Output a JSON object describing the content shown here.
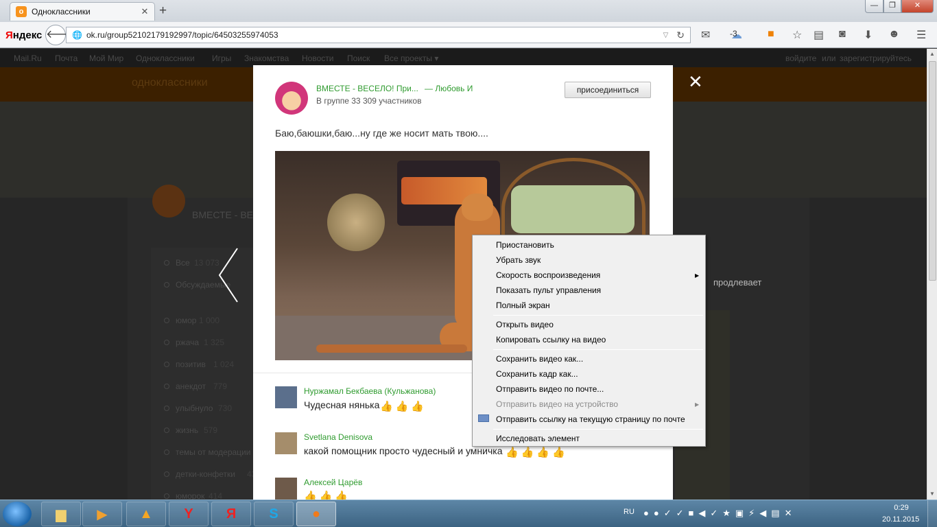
{
  "browser": {
    "tab_title": "Одноклассники",
    "tab_favicon": "ok",
    "new_tab_icon": "+",
    "brand_prefix": "Я",
    "brand_rest": "ндекс",
    "url": "ok.ru/group52102179192997/topic/64503255974053",
    "weather_temp": "-3",
    "window": {
      "min": "—",
      "max": "❐",
      "close": "✕"
    }
  },
  "bg_page": {
    "portal_links": [
      "Mail.Ru",
      "Почта",
      "Мой Мир",
      "Одноклассники",
      "Игры",
      "Знакомства",
      "Новости",
      "Поиск",
      "Все проекты ▾"
    ],
    "login": "войдите",
    "or": "или",
    "register": "зарегистрируйтесь",
    "site_name": "одноклассники",
    "group_title": "ВМЕСТЕ - ВЕ",
    "right_text": "продлевает",
    "sidebar": [
      {
        "label": "Все",
        "count": "13 073"
      },
      {
        "label": "Обсуждаемые",
        "count": ""
      },
      {
        "label": "юмор",
        "count": "1 000"
      },
      {
        "label": "ржача",
        "count": "1 325"
      },
      {
        "label": "позитив",
        "count": "1 024"
      },
      {
        "label": "анекдот",
        "count": "779"
      },
      {
        "label": "улыбнуло",
        "count": "730"
      },
      {
        "label": "жизнь",
        "count": "579"
      },
      {
        "label": "темы от модерации",
        "count": ""
      },
      {
        "label": "детки-конфетки",
        "count": "430"
      },
      {
        "label": "юморок",
        "count": "414"
      }
    ]
  },
  "post": {
    "group_name": "ВМЕСТЕ - ВЕСЕЛО! При...",
    "author": "— Любовь И",
    "members": "В группе 33 309 участников",
    "join_label": "присоединиться",
    "text": "Баю,баюшки,баю...ну где же носит мать твою...."
  },
  "comments": [
    {
      "name": "Нуржамал Бекбаева (Кульжанова)",
      "text": "Чудесная нянька",
      "thumbs": "👍👍👍"
    },
    {
      "name": "Svetlana Denisova",
      "text": "какой помощник просто чудесный и умничка",
      "thumbs": "👍👍👍👍"
    },
    {
      "name": "Алексей Царёв",
      "text": "",
      "thumbs": "👍👍👍"
    }
  ],
  "context_menu": {
    "items": [
      {
        "label": "Приостановить",
        "enabled": true,
        "submenu": false
      },
      {
        "label": "Убрать звук",
        "enabled": true,
        "submenu": false
      },
      {
        "label": "Скорость воспроизведения",
        "enabled": true,
        "submenu": true
      },
      {
        "label": "Показать пульт управления",
        "enabled": true,
        "submenu": false
      },
      {
        "label": "Полный экран",
        "enabled": true,
        "submenu": false
      },
      {
        "label": "Открыть видео",
        "enabled": true,
        "submenu": false
      },
      {
        "label": "Копировать ссылку на видео",
        "enabled": true,
        "submenu": false
      },
      {
        "label": "Сохранить видео как...",
        "enabled": true,
        "submenu": false
      },
      {
        "label": "Сохранить кадр как...",
        "enabled": true,
        "submenu": false
      },
      {
        "label": "Отправить видео по почте...",
        "enabled": true,
        "submenu": false
      },
      {
        "label": "Отправить видео на устройство",
        "enabled": false,
        "submenu": true
      },
      {
        "label": "Отправить ссылку на текущую страницу по почте",
        "enabled": true,
        "submenu": false
      },
      {
        "label": "Исследовать элемент",
        "enabled": true,
        "submenu": false
      }
    ]
  },
  "taskbar": {
    "lang": "RU",
    "time": "0:29",
    "date": "20.11.2015",
    "apps": [
      "explorer",
      "media-player",
      "aimp",
      "yandex-browser",
      "yandex",
      "skype",
      "firefox"
    ]
  },
  "colors": {
    "ok_orange": "#ee8208",
    "link_green": "#2f9b2f",
    "taskbar": "#3c6382"
  }
}
